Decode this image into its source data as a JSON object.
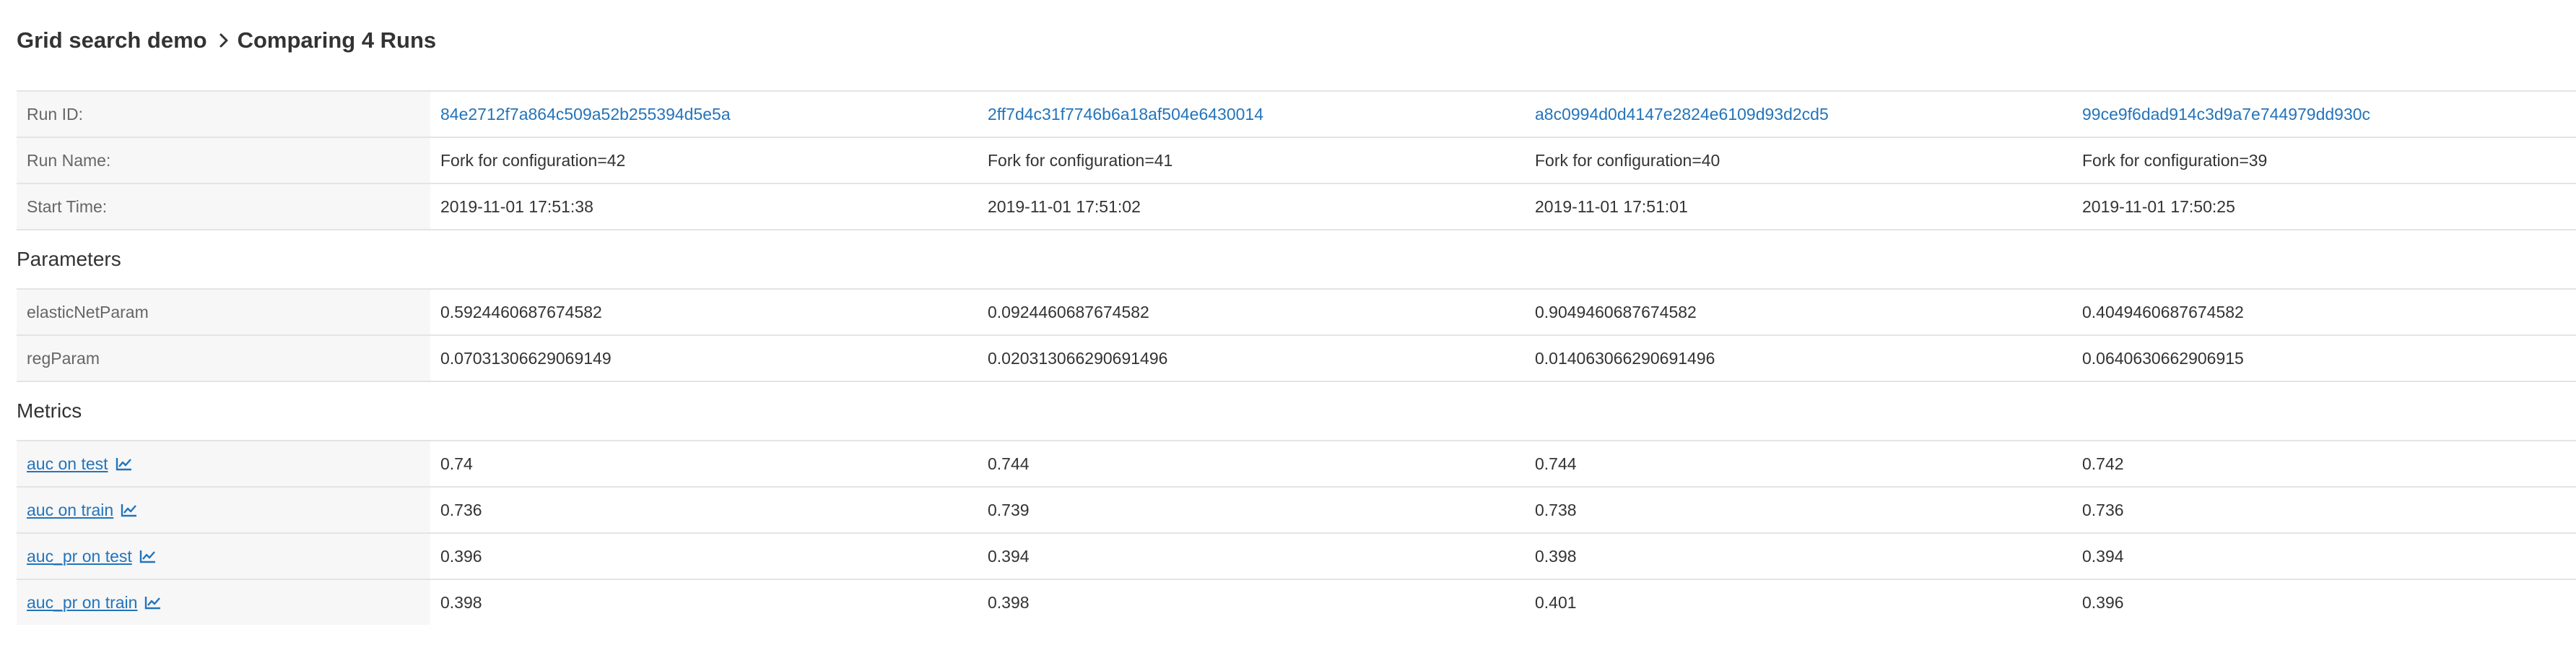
{
  "breadcrumb": {
    "experiment": "Grid search demo",
    "current": "Comparing 4 Runs"
  },
  "run_info": {
    "run_id_label": "Run ID:",
    "run_name_label": "Run Name:",
    "start_time_label": "Start Time:",
    "runs": [
      {
        "id": "84e2712f7a864c509a52b255394d5e5a",
        "name": "Fork for configuration=42",
        "start_time": "2019-11-01 17:51:38"
      },
      {
        "id": "2ff7d4c31f7746b6a18af504e6430014",
        "name": "Fork for configuration=41",
        "start_time": "2019-11-01 17:51:02"
      },
      {
        "id": "a8c0994d0d4147e2824e6109d93d2cd5",
        "name": "Fork for configuration=40",
        "start_time": "2019-11-01 17:51:01"
      },
      {
        "id": "99ce9f6dad914c3d9a7e744979dd930c",
        "name": "Fork for configuration=39",
        "start_time": "2019-11-01 17:50:25"
      }
    ]
  },
  "parameters": {
    "title": "Parameters",
    "rows": [
      {
        "name": "elasticNetParam",
        "values": [
          "0.5924460687674582",
          "0.0924460687674582",
          "0.9049460687674582",
          "0.4049460687674582"
        ]
      },
      {
        "name": "regParam",
        "values": [
          "0.07031306629069149",
          "0.020313066290691496",
          "0.014063066290691496",
          "0.0640630662906915"
        ]
      }
    ]
  },
  "metrics": {
    "title": "Metrics",
    "chart_icon": "line-chart-icon",
    "rows": [
      {
        "name": "auc on test",
        "values": [
          "0.74",
          "0.744",
          "0.744",
          "0.742"
        ]
      },
      {
        "name": "auc on train",
        "values": [
          "0.736",
          "0.739",
          "0.738",
          "0.736"
        ]
      },
      {
        "name": "auc_pr on test",
        "values": [
          "0.396",
          "0.394",
          "0.398",
          "0.394"
        ]
      },
      {
        "name": "auc_pr on train",
        "values": [
          "0.398",
          "0.398",
          "0.401",
          "0.396"
        ]
      }
    ]
  },
  "colors": {
    "link": "#2374bb",
    "label_bg": "#f7f7f7",
    "border": "#e4e4e4",
    "text": "#333333"
  }
}
